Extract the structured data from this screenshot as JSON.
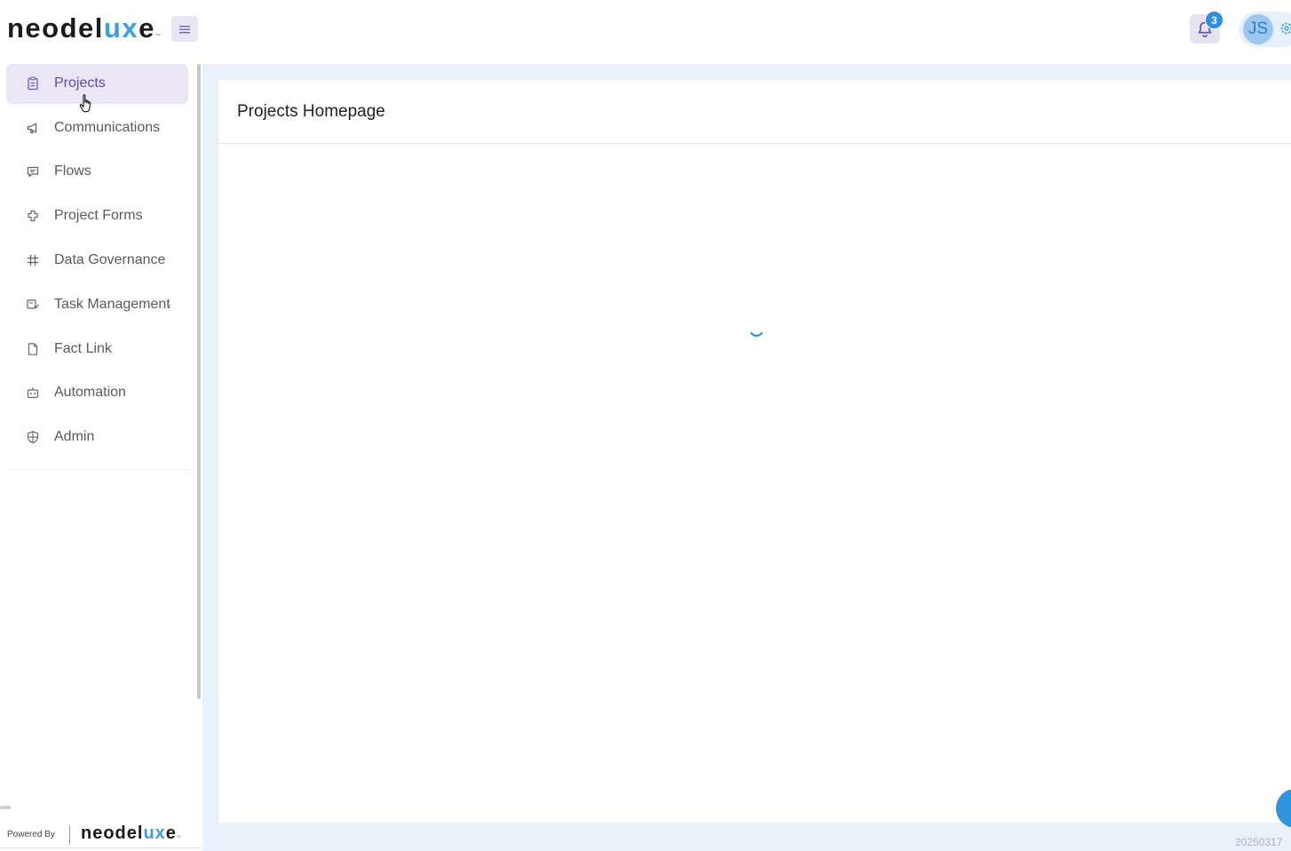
{
  "header": {
    "logo_main": "neodel",
    "logo_accent": "ux",
    "logo_end": "e",
    "logo_tm": "™",
    "menu_icon": "hamburger-icon",
    "notification_icon": "bell-icon",
    "notification_count": "3",
    "user_initials": "JS",
    "settings_icon": "gear-icon"
  },
  "sidebar": {
    "items": [
      {
        "label": "Projects",
        "icon": "clipboard-icon",
        "active": true
      },
      {
        "label": "Communications",
        "icon": "megaphone-icon"
      },
      {
        "label": "Flows",
        "icon": "chat-icon"
      },
      {
        "label": "Project Forms",
        "icon": "puzzle-icon"
      },
      {
        "label": "Data Governance",
        "icon": "grid-hash-icon"
      },
      {
        "label": "Task Management",
        "icon": "task-icon",
        "has_submenu": true,
        "chevron": "⌄"
      },
      {
        "label": "Fact Link",
        "icon": "file-icon"
      },
      {
        "label": "Automation",
        "icon": "robot-icon"
      },
      {
        "label": "Admin",
        "icon": "shield-icon"
      }
    ],
    "powered_by": "Powered By",
    "footer_logo_main": "neodel",
    "footer_logo_accent": "ux",
    "footer_logo_end": "e",
    "footer_logo_tm": "™"
  },
  "main": {
    "title": "Projects Homepage",
    "loading": true,
    "build_version": "20250317"
  },
  "colors": {
    "accent": "#3b9ee3",
    "active_bg": "#ebe6f6",
    "active_text": "#5d4aa8",
    "content_bg": "#e9f2fb"
  }
}
